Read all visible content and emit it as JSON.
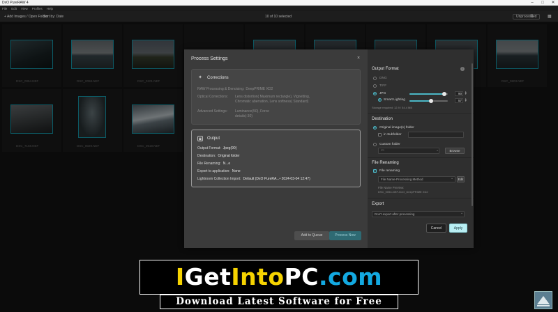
{
  "window": {
    "title": "DxO PureRAW 4",
    "controls": [
      "–",
      "□",
      "✕"
    ]
  },
  "menu": [
    "File",
    "Edit",
    "View",
    "Profiles",
    "Help"
  ],
  "toolbar": {
    "add_label": "+ Add Images / Open Folder",
    "sort_label": "Sort by: Date",
    "selection_count": "10 of 10 selected",
    "filter_label": "Unprocessed",
    "icons": [
      "sort-icon",
      "grid-view-icon"
    ]
  },
  "thumbnails": [
    {
      "name": "DSC_0054.NEF",
      "scene": "forest-night"
    },
    {
      "name": "DSC_0058.NEF",
      "scene": "shore"
    },
    {
      "name": "DSC_0101.NEF",
      "scene": "hills"
    },
    {
      "name": "",
      "scene": "dark"
    },
    {
      "name": "",
      "scene": "dark"
    },
    {
      "name": "",
      "scene": "dark"
    },
    {
      "name": "",
      "scene": "dark"
    },
    {
      "name": "",
      "scene": "dark"
    },
    {
      "name": "",
      "scene": "dark"
    },
    {
      "name": "DSC_0803.NEF",
      "scene": "lake"
    },
    {
      "name": "DSC_7158.NEF",
      "scene": "rocks"
    },
    {
      "name": "DSC_8029.NEF",
      "scene": "silhouette"
    },
    {
      "name": "DSC_0519.NEF",
      "scene": "mountain"
    }
  ],
  "dialog": {
    "title": "Process Settings",
    "close": "×",
    "corrections": {
      "title": "Corrections",
      "rows": [
        {
          "k": "RAW Processing & Denoising:",
          "v": "DeepPRIME XD2"
        },
        {
          "k": "Optical Corrections:",
          "v": "Lens distortion( Maximum rectangle), Vignetting, Chromatic aberration, Lens softness( Standard)"
        },
        {
          "k": "Advanced Settings:",
          "v": "Luminance(50), Force details(-30)"
        }
      ]
    },
    "output": {
      "title": "Output",
      "rows": [
        {
          "k": "Output Format:",
          "v": "Jpeg(90)"
        },
        {
          "k": "Destination:",
          "v": "Original folder"
        },
        {
          "k": "File Renaming:",
          "v": "N...e"
        },
        {
          "k": "Export to application:",
          "v": "None"
        },
        {
          "k": "Lightroom Collection Import:",
          "v": "Default (DxO PureRA...• 2024-03-04 12:47)"
        }
      ]
    },
    "add_to_queue": "Add to Queue",
    "process_now": "Process Now",
    "right": {
      "output_format_title": "Output Format",
      "formats": [
        {
          "label": "DNG",
          "checked": false
        },
        {
          "label": "TIFF",
          "checked": false
        },
        {
          "label": "JPG",
          "checked": true
        }
      ],
      "jpg_quality": 90,
      "smart_lighting_label": "Smart Lighting",
      "smart_lighting": 57,
      "storage_note": "Storage required: 12.9 / 54.4 MB",
      "destination_title": "Destination",
      "dest_original": "Original image(s) folder",
      "dest_subfolder": "in Subfolder",
      "dest_custom": "Custom folder",
      "browse": "Browse",
      "renaming_title": "File Renaming",
      "file_renaming": "File renaming",
      "renaming_pattern": "File Name-Processing Method",
      "edit": "Edit",
      "preview_label": "File Name Preview:",
      "preview_value": "DSC_0054-NEF-DxO_DeepPRIME XD2",
      "export_title": "Export",
      "export_value": "Don't export after processing",
      "cancel": "Cancel",
      "apply": "Apply"
    }
  },
  "watermark": {
    "w1": "I",
    "w2": "Get",
    "w3": "Into",
    "w4": "PC",
    "w5": ".com",
    "tagline": "Download Latest Software for Free"
  },
  "colors": {
    "accent": "#4bb7c6",
    "apply_bg": "#b9eef3",
    "thumb_border": "#16a5b8"
  }
}
